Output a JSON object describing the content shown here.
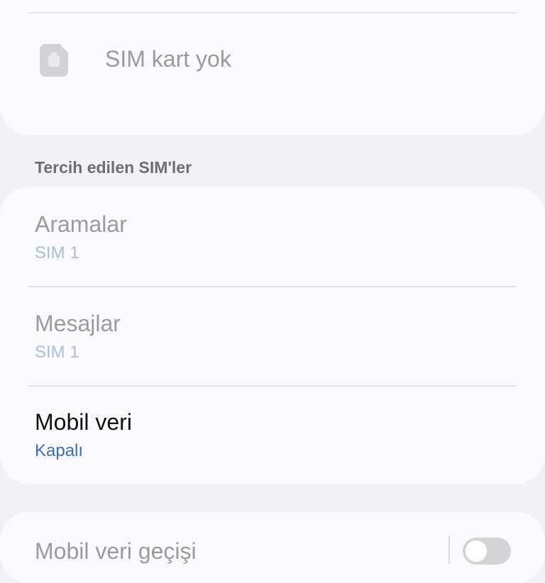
{
  "sim_card": {
    "icon": "sim-card-icon",
    "label": "SIM kart yok"
  },
  "preferred_sims": {
    "header": "Tercih edilen SIM'ler",
    "items": [
      {
        "title": "Aramalar",
        "value": "SIM 1",
        "enabled": false
      },
      {
        "title": "Mesajlar",
        "value": "SIM 1",
        "enabled": false
      },
      {
        "title": "Mobil veri",
        "value": "Kapalı",
        "enabled": true
      }
    ]
  },
  "next_setting": {
    "label": "Mobil veri geçişi",
    "toggle_on": false
  },
  "colors": {
    "background": "#f2f2f4",
    "card": "#fafafd",
    "accent": "#3b6dbf",
    "accent_disabled": "#a6bee0"
  }
}
